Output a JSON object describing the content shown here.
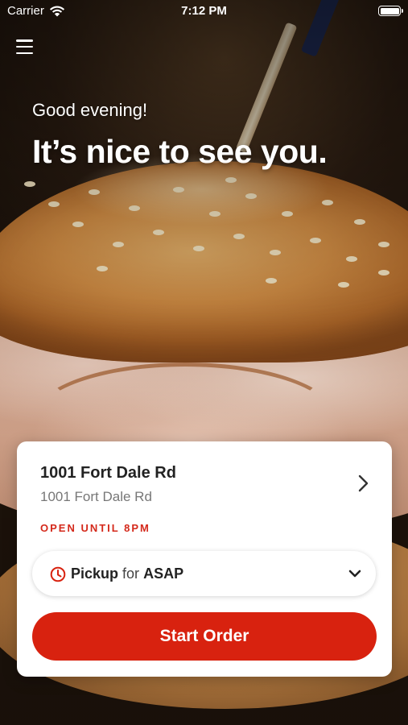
{
  "status_bar": {
    "carrier": "Carrier",
    "time": "7:12 PM",
    "wifi_icon": "wifi-icon",
    "battery_icon": "battery-icon"
  },
  "header": {
    "menu_icon": "hamburger-menu-icon",
    "greeting": "Good evening!",
    "headline": "It’s nice to see you."
  },
  "hero": {
    "background_image": "turkey-sandwich-photo"
  },
  "card": {
    "location_name": "1001 Fort Dale Rd",
    "location_address": "1001 Fort Dale Rd",
    "hours": "OPEN UNTIL 8PM",
    "hours_color": "#d4291b",
    "order_type": "Pickup",
    "for_label": "for",
    "order_time": "ASAP",
    "start_order_label": "Start Order",
    "accent_color": "#d8220f"
  }
}
